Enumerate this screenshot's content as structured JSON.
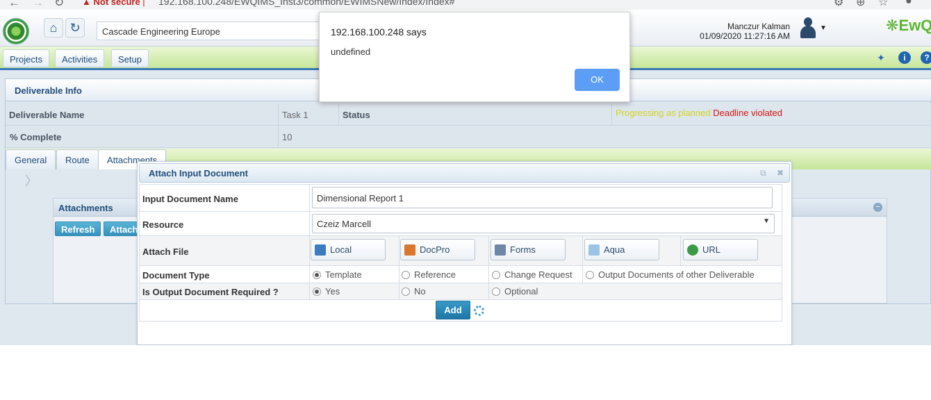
{
  "browser": {
    "security_warning": "Not secure",
    "url": "192.168.100.248/EWQIMS_Inst3/common/EWIMSNew/Index/Index#"
  },
  "header": {
    "company": "Cascade Engineering Europe",
    "user_name": "Manczur Kalman",
    "datetime": "01/09/2020 11:27:16 AM",
    "brand": "EwQ"
  },
  "menu": {
    "items": [
      "Projects",
      "Activities",
      "Setup"
    ]
  },
  "deliverable": {
    "title": "Deliverable Info",
    "name_label": "Deliverable Name",
    "name_value": "Task 1",
    "status_label": "Status",
    "status_progressing": "Progressing as planned",
    "status_deadline": "Deadline violated",
    "complete_label": "% Complete",
    "complete_value": "10"
  },
  "tabs": [
    "General",
    "Route",
    "Attachments"
  ],
  "attachments": {
    "title": "Attachments",
    "refresh_label": "Refresh",
    "attach_label": "Attach"
  },
  "dialog": {
    "title": "Attach Input Document",
    "input_name_label": "Input Document Name",
    "input_name_value": "Dimensional Report 1",
    "resource_label": "Resource",
    "resource_value": "Czeiz Marcell",
    "attach_file_label": "Attach File",
    "attach_buttons": [
      "Local",
      "DocPro",
      "Forms",
      "Aqua",
      "URL"
    ],
    "doc_type_label": "Document Type",
    "doc_types": [
      "Template",
      "Reference",
      "Change Request",
      "Output Documents of other Deliverable"
    ],
    "doc_type_selected": "Template",
    "required_label": "Is Output Document Required ?",
    "required_options": [
      "Yes",
      "No",
      "Optional"
    ],
    "required_selected": "Yes",
    "add_label": "Add"
  },
  "alert": {
    "title": "192.168.100.248 says",
    "message": "undefined",
    "ok_label": "OK"
  },
  "colors": {
    "accent_blue": "#1e76a6",
    "menu_green": "#c6e69a",
    "status_yellow": "#d2d41f",
    "status_red": "#dd1111"
  }
}
